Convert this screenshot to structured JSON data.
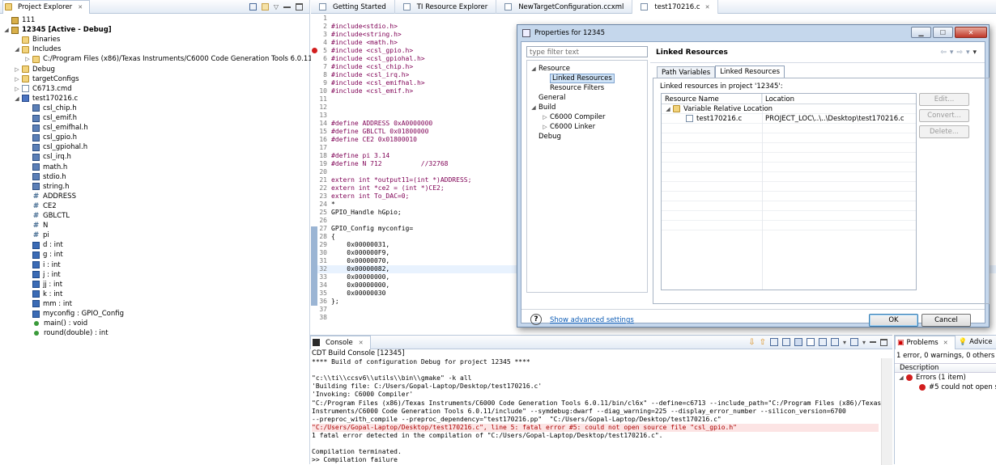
{
  "project_explorer": {
    "tab_label": "Project Explorer",
    "tab_close": "✕",
    "tree": [
      {
        "label": "111",
        "icon": "project-icon",
        "indent": 0,
        "twisty": ""
      },
      {
        "label": "12345  [Active - Debug]",
        "icon": "project-icon",
        "indent": 0,
        "twisty": "◢",
        "bold": true
      },
      {
        "label": "Binaries",
        "icon": "folder-icon",
        "indent": 1,
        "twisty": ""
      },
      {
        "label": "Includes",
        "icon": "folder-icon",
        "indent": 1,
        "twisty": "◢"
      },
      {
        "label": "C:/Program Files (x86)/Texas Instruments/C6000 Code Generation Tools 6.0.11/include",
        "icon": "folder-icon",
        "indent": 2,
        "twisty": "▷"
      },
      {
        "label": "Debug",
        "icon": "folder-icon",
        "indent": 1,
        "twisty": "▷"
      },
      {
        "label": "targetConfigs",
        "icon": "folder-icon",
        "indent": 1,
        "twisty": "▷"
      },
      {
        "label": "C6713.cmd",
        "icon": "file-icon",
        "indent": 1,
        "twisty": "▷"
      },
      {
        "label": "test170216.c",
        "icon": "c-file-icon",
        "indent": 1,
        "twisty": "◢"
      },
      {
        "label": "csl_chip.h",
        "icon": "header-icon",
        "indent": 2,
        "twisty": ""
      },
      {
        "label": "csl_emif.h",
        "icon": "header-icon",
        "indent": 2,
        "twisty": ""
      },
      {
        "label": "csl_emifhal.h",
        "icon": "header-icon",
        "indent": 2,
        "twisty": ""
      },
      {
        "label": "csl_gpio.h",
        "icon": "header-icon",
        "indent": 2,
        "twisty": ""
      },
      {
        "label": "csl_gpiohal.h",
        "icon": "header-icon",
        "indent": 2,
        "twisty": ""
      },
      {
        "label": "csl_irq.h",
        "icon": "header-icon",
        "indent": 2,
        "twisty": ""
      },
      {
        "label": "math.h",
        "icon": "header-icon",
        "indent": 2,
        "twisty": ""
      },
      {
        "label": "stdio.h",
        "icon": "header-icon",
        "indent": 2,
        "twisty": ""
      },
      {
        "label": "string.h",
        "icon": "header-icon",
        "indent": 2,
        "twisty": ""
      },
      {
        "label": "ADDRESS",
        "icon": "macro-icon",
        "indent": 2,
        "twisty": ""
      },
      {
        "label": "CE2",
        "icon": "macro-icon",
        "indent": 2,
        "twisty": ""
      },
      {
        "label": "GBLCTL",
        "icon": "macro-icon",
        "indent": 2,
        "twisty": ""
      },
      {
        "label": "N",
        "icon": "macro-icon",
        "indent": 2,
        "twisty": ""
      },
      {
        "label": "pi",
        "icon": "macro-icon",
        "indent": 2,
        "twisty": ""
      },
      {
        "label": "d : int",
        "icon": "variable-icon",
        "indent": 2,
        "twisty": ""
      },
      {
        "label": "g : int",
        "icon": "variable-icon",
        "indent": 2,
        "twisty": ""
      },
      {
        "label": "i : int",
        "icon": "variable-icon",
        "indent": 2,
        "twisty": ""
      },
      {
        "label": "j : int",
        "icon": "variable-icon",
        "indent": 2,
        "twisty": ""
      },
      {
        "label": "jj : int",
        "icon": "variable-icon",
        "indent": 2,
        "twisty": ""
      },
      {
        "label": "k : int",
        "icon": "variable-icon",
        "indent": 2,
        "twisty": ""
      },
      {
        "label": "mm : int",
        "icon": "variable-icon",
        "indent": 2,
        "twisty": ""
      },
      {
        "label": "myconfig : GPIO_Config",
        "icon": "variable-icon",
        "indent": 2,
        "twisty": ""
      },
      {
        "label": "main() : void",
        "icon": "function-icon",
        "indent": 2,
        "twisty": ""
      },
      {
        "label": "round(double) : int",
        "icon": "function-icon",
        "indent": 2,
        "twisty": ""
      }
    ]
  },
  "editor": {
    "tabs": [
      {
        "label": "Getting Started",
        "active": false
      },
      {
        "label": "TI Resource Explorer",
        "active": false
      },
      {
        "label": "NewTargetConfiguration.ccxml",
        "active": false
      },
      {
        "label": "test170216.c",
        "active": true
      }
    ],
    "lines": [
      {
        "n": "1",
        "t": ""
      },
      {
        "n": "2",
        "t": "#include<stdio.h>"
      },
      {
        "n": "3",
        "t": "#include<string.h>"
      },
      {
        "n": "4",
        "t": "#include <math.h>"
      },
      {
        "n": "5",
        "t": "#include <csl_gpio.h>",
        "error": true
      },
      {
        "n": "6",
        "t": "#include <csl_gpiohal.h>"
      },
      {
        "n": "7",
        "t": "#include <csl_chip.h>"
      },
      {
        "n": "8",
        "t": "#include <csl_irq.h>"
      },
      {
        "n": "9",
        "t": "#include <csl_emifhal.h>"
      },
      {
        "n": "10",
        "t": "#include <csl_emif.h>"
      },
      {
        "n": "11",
        "t": ""
      },
      {
        "n": "12",
        "t": ""
      },
      {
        "n": "13",
        "t": ""
      },
      {
        "n": "14",
        "t": "#define ADDRESS 0xA0000000"
      },
      {
        "n": "15",
        "t": "#define GBLCTL 0x01800000"
      },
      {
        "n": "16",
        "t": "#define CE2 0x01800010"
      },
      {
        "n": "17",
        "t": ""
      },
      {
        "n": "18",
        "t": "#define pi 3.14"
      },
      {
        "n": "19",
        "t": "#define N 712          //32768"
      },
      {
        "n": "20",
        "t": ""
      },
      {
        "n": "21",
        "t": "extern int *output11=(int *)ADDRESS;"
      },
      {
        "n": "22",
        "t": "extern int *ce2 = (int *)CE2;"
      },
      {
        "n": "23",
        "t": "extern int To_DAC=0;"
      },
      {
        "n": "24",
        "t": "*"
      },
      {
        "n": "25",
        "t": "GPIO_Handle hGpio;"
      },
      {
        "n": "26",
        "t": ""
      },
      {
        "n": "27",
        "t": "GPIO_Config myconfig="
      },
      {
        "n": "28",
        "t": "{"
      },
      {
        "n": "29",
        "t": "    0x00000031,"
      },
      {
        "n": "30",
        "t": "    0x000000F9,"
      },
      {
        "n": "31",
        "t": "    0x00000070,"
      },
      {
        "n": "32",
        "t": "    0x00000082,",
        "highlight": true
      },
      {
        "n": "33",
        "t": "    0x00000000,"
      },
      {
        "n": "34",
        "t": "    0x00000000,"
      },
      {
        "n": "35",
        "t": "    0x00000030"
      },
      {
        "n": "36",
        "t": "};"
      },
      {
        "n": "37",
        "t": ""
      },
      {
        "n": "38",
        "t": ""
      }
    ]
  },
  "console": {
    "tab_label": "Console",
    "subtitle": "CDT Build Console [12345]",
    "lines": [
      {
        "t": "**** Build of configuration Debug for project 12345 ****"
      },
      {
        "t": ""
      },
      {
        "t": "\"c:\\\\ti\\\\ccsv6\\\\utils\\\\bin\\\\gmake\" -k all"
      },
      {
        "t": "'Building file: C:/Users/Gopal-Laptop/Desktop/test170216.c'"
      },
      {
        "t": "'Invoking: C6000 Compiler'"
      },
      {
        "t": "\"C:/Program Files (x86)/Texas Instruments/C6000 Code Generation Tools 6.0.11/bin/cl6x\" --define=c6713 --include_path=\"C:/Program Files (x86)/Texas"
      },
      {
        "t": "Instruments/C6000 Code Generation Tools 6.0.11/include\" --symdebug:dwarf --diag_warning=225 --display_error_number --silicon_version=6700"
      },
      {
        "t": "--preproc_with_compile --preproc_dependency=\"test170216.pp\"  \"C:/Users/Gopal-Laptop/Desktop/test170216.c\""
      },
      {
        "t": "\"C:/Users/Gopal-Laptop/Desktop/test170216.c\", line 5: fatal error #5: could not open source file \"csl_gpio.h\"",
        "error": true
      },
      {
        "t": "1 fatal error detected in the compilation of \"C:/Users/Gopal-Laptop/Desktop/test170216.c\"."
      },
      {
        "t": ""
      },
      {
        "t": "Compilation terminated."
      },
      {
        "t": ">> Compilation failure"
      }
    ]
  },
  "problems": {
    "tab_label": "Problems",
    "advice_label": "Advice",
    "summary": "1 error, 0 warnings, 0 others",
    "col_description": "Description",
    "group_label": "Errors (1 item)",
    "item_label": "#5 could not open sour"
  },
  "dialog": {
    "title": "Properties for 12345",
    "filter_placeholder": "type filter text",
    "nav": [
      {
        "label": "Resource",
        "indent": 0,
        "twisty": "◢"
      },
      {
        "label": "Linked Resources",
        "indent": 1,
        "twisty": "",
        "selected": true
      },
      {
        "label": "Resource Filters",
        "indent": 1,
        "twisty": ""
      },
      {
        "label": "General",
        "indent": 0,
        "twisty": ""
      },
      {
        "label": "Build",
        "indent": 0,
        "twisty": "◢"
      },
      {
        "label": "C6000 Compiler",
        "indent": 1,
        "twisty": "▷"
      },
      {
        "label": "C6000 Linker",
        "indent": 1,
        "twisty": "▷"
      },
      {
        "label": "Debug",
        "indent": 0,
        "twisty": ""
      }
    ],
    "page_title": "Linked Resources",
    "tabs": [
      "Path Variables",
      "Linked Resources"
    ],
    "section_label": "Linked resources in project '12345':",
    "col_name": "Resource Name",
    "col_location": "Location",
    "group_name": "Variable Relative Location",
    "row_name": "test170216.c",
    "row_location": "PROJECT_LOC\\..\\..\\Desktop\\test170216.c",
    "btn_edit": "Edit...",
    "btn_convert": "Convert...",
    "btn_delete": "Delete...",
    "advanced_link": "Show advanced settings",
    "btn_ok": "OK",
    "btn_cancel": "Cancel"
  }
}
